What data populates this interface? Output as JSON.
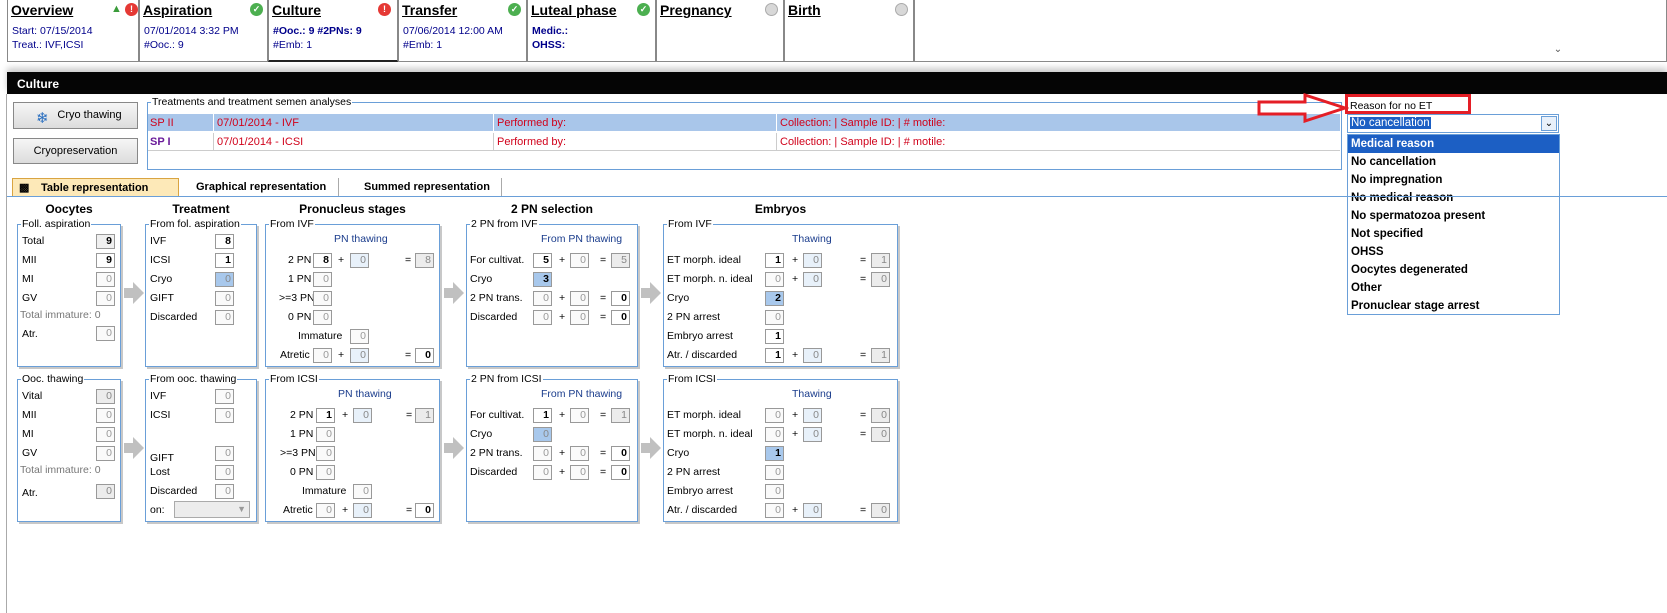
{
  "tabs": [
    {
      "title": "Overview",
      "ul": "O",
      "rest": "verview",
      "l1": "Start: 07/15/2014",
      "l2": "Treat.: IVF,ICSI",
      "status": "red"
    },
    {
      "title": "Aspiration",
      "ul": "A",
      "rest": "spiration",
      "l1": "07/01/2014 3:32 PM",
      "l2": "#Ooc.: 9",
      "status": "green"
    },
    {
      "title": "Culture",
      "ul": "C",
      "rest": "ulture",
      "l1": "#Ooc.: 9 #2PNs: 9",
      "l2": "#Emb: 1",
      "status": "red"
    },
    {
      "title": "Transfer",
      "ul": "T",
      "rest": "ransfer",
      "l1": "07/06/2014 12:00 AM",
      "l2": "#Emb: 1",
      "status": "green"
    },
    {
      "title": "Luteal phase",
      "ul": "L",
      "rest": "uteal phase",
      "l1": "Medic.:",
      "l2": "OHSS:",
      "status": "green"
    },
    {
      "title": "Pregnancy",
      "ul": "P",
      "rest": "regnancy",
      "l1": "",
      "l2": "",
      "status": "grey"
    },
    {
      "title": "Birth",
      "ul": "B",
      "rest": "irth",
      "l1": "",
      "l2": "",
      "status": "grey"
    }
  ],
  "section_title": "Culture",
  "buttons": {
    "cryo_thawing": "Cryo thawing",
    "cryopreservation": "Cryopreservation"
  },
  "treatments": {
    "caption": "Treatments and treatment semen analyses",
    "rows": [
      {
        "id": "SP II",
        "date": "07/01/2014 - IVF",
        "performed": "Performed by:",
        "collection": "Collection:  | Sample ID:  | # motile:"
      },
      {
        "id": "SP I",
        "date": "07/01/2014 - ICSI",
        "performed": "Performed by:",
        "collection": "Collection:  | Sample ID:  | # motile:"
      }
    ]
  },
  "reason": {
    "label": "Reason for no ET",
    "selected": "No cancellation",
    "options": [
      "Medical reason",
      "No cancellation",
      "No impregnation",
      "No medical reason",
      "No spermatozoa present",
      "Not specified",
      "OHSS",
      "Oocytes degenerated",
      "Other",
      "Pronuclear stage arrest"
    ]
  },
  "view_tabs": [
    "Table representation",
    "Graphical representation",
    "Summed representation"
  ],
  "headers": {
    "oocytes": "Oocytes",
    "treatment": "Treatment",
    "pronucleus": "Pronucleus stages",
    "selection": "2 PN selection",
    "embryos": "Embryos"
  },
  "captions": {
    "foll": "Foll. aspiration",
    "from_fol": "From fol. aspiration",
    "from_ivf": "From IVF",
    "from_ivf2": "2 PN from IVF",
    "from_ivf3": "From IVF",
    "ooc": "Ooc. thawing",
    "from_ooc": "From ooc. thawing",
    "from_icsi": "From ICSI",
    "from_icsi2": "2 PN from ICSI",
    "from_icsi3": "From ICSI"
  },
  "labels": {
    "total": "Total",
    "mii": "MII",
    "mi": "MI",
    "gv": "GV",
    "total_immature": "Total immature: 0",
    "atr": "Atr.",
    "vital": "Vital",
    "ivf": "IVF",
    "icsi": "ICSI",
    "cryo": "Cryo",
    "gift": "GIFT",
    "discarded": "Discarded",
    "lost": "Lost",
    "on": "on:",
    "pn_thawing": "PN thawing",
    "pn2": "2 PN",
    "pn1": "1 PN",
    "pn3": ">=3 PN",
    "pn0": "0 PN",
    "immature": "Immature",
    "atretic": "Atretic",
    "from_pn": "From PN thawing",
    "for_cultivat": "For cultivat.",
    "pn2_trans": "2 PN trans.",
    "thawing": "Thawing",
    "et_ideal": "ET morph. ideal",
    "et_nideal": "ET morph. n. ideal",
    "pn2_arrest": "2 PN arrest",
    "emb_arrest": "Embryo arrest",
    "atr_disc": "Atr. / discarded",
    "plus": "+",
    "eq": "="
  },
  "values": {
    "foll": [
      "9",
      "9",
      "0",
      "0",
      "0"
    ],
    "fol_tr": [
      "8",
      "1",
      "0",
      "0",
      "0"
    ],
    "ivf_pn": {
      "pn2": "8",
      "pn2t": "0",
      "pn2s": "8",
      "pn1": "0",
      "pn3": "0",
      "pn0": "0",
      "imm": "0",
      "atr": "0",
      "atrt": "0",
      "atrs": "0"
    },
    "ivf_sel": {
      "cult": "5",
      "cultt": "0",
      "cults": "5",
      "cryo": "3",
      "trans": "0",
      "transt": "0",
      "transs": "0",
      "disc": "0",
      "disct": "0",
      "discs": "0"
    },
    "ivf_emb": {
      "ideal": "1",
      "idealt": "0",
      "ideals": "1",
      "nideal": "0",
      "nidealt": "0",
      "nideals": "0",
      "cryo": "2",
      "arr2": "0",
      "emb": "1",
      "atr": "1",
      "atrt": "0",
      "atrs": "1"
    },
    "ooc": [
      "0",
      "0",
      "0",
      "0",
      "0"
    ],
    "ooc_tr": [
      "0",
      "0",
      "0",
      "0",
      "0"
    ],
    "icsi_pn": {
      "pn2": "1",
      "pn2t": "0",
      "pn2s": "1",
      "pn1": "0",
      "pn3": "0",
      "pn0": "0",
      "imm": "0",
      "atr": "0",
      "atrt": "0",
      "atrs": "0"
    },
    "icsi_sel": {
      "cult": "1",
      "cultt": "0",
      "cults": "1",
      "cryo": "0",
      "trans": "0",
      "transt": "0",
      "transs": "0",
      "disc": "0",
      "disct": "0",
      "discs": "0"
    },
    "icsi_emb": {
      "ideal": "0",
      "idealt": "0",
      "ideals": "0",
      "nideal": "0",
      "nidealt": "0",
      "nideals": "0",
      "cryo": "1",
      "arr2": "0",
      "emb": "0",
      "atr": "0",
      "atrt": "0",
      "atrs": "0"
    }
  }
}
